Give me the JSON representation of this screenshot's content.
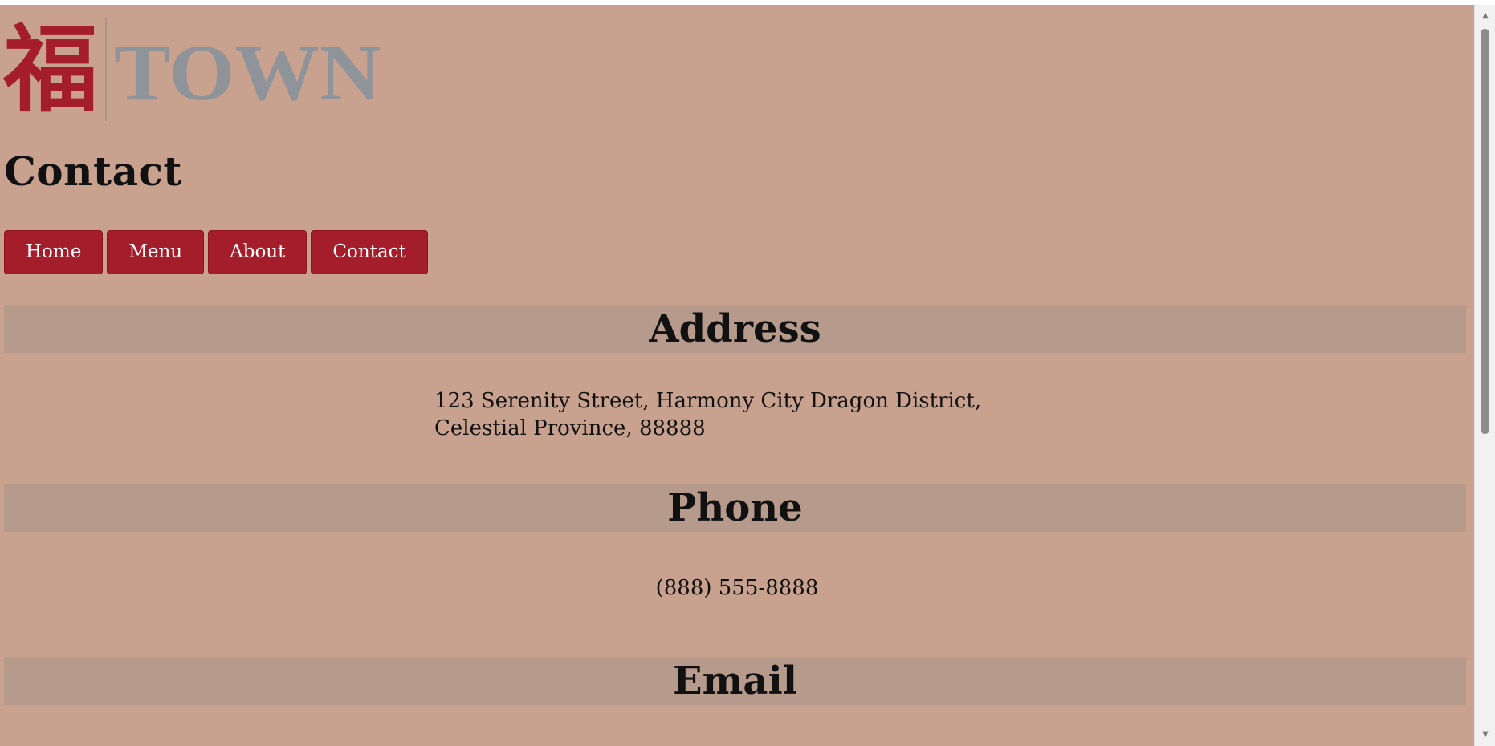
{
  "logo": {
    "glyph": "福",
    "wordmark": "TOWN",
    "glyph_color": "#a31d2b",
    "wordmark_color": "#8f949b"
  },
  "page": {
    "title": "Contact",
    "background": "#c8a28f"
  },
  "nav": {
    "items": [
      {
        "label": "Home"
      },
      {
        "label": "Menu"
      },
      {
        "label": "About"
      },
      {
        "label": "Contact"
      }
    ],
    "button_color": "#a31d2b"
  },
  "sections": {
    "address": {
      "heading": "Address",
      "text": "123 Serenity Street, Harmony City Dragon District, Celestial Province, 88888"
    },
    "phone": {
      "heading": "Phone",
      "text": "(888) 555-8888"
    },
    "email": {
      "heading": "Email"
    }
  }
}
